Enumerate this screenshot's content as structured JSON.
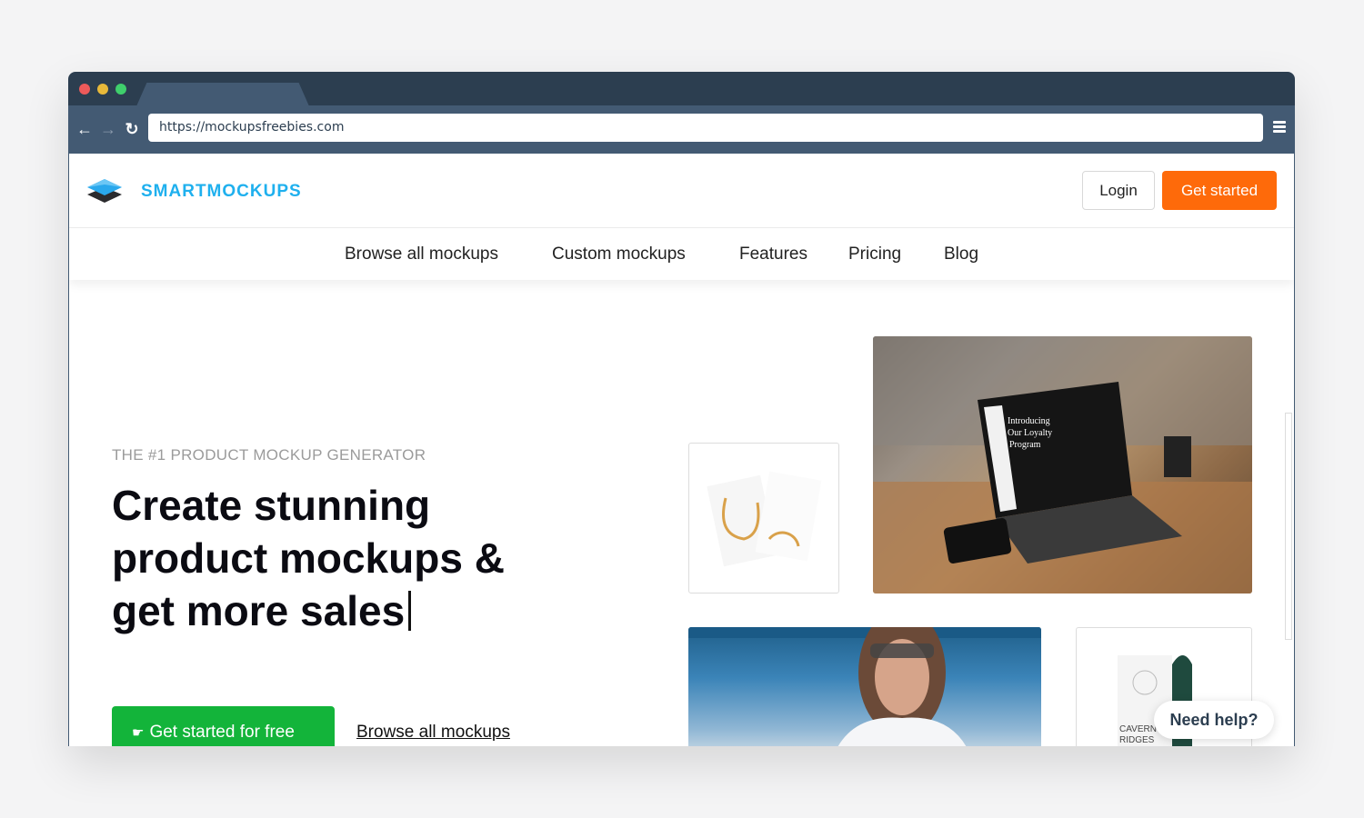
{
  "browser": {
    "url": "https://mockupsfreebies.com",
    "back_icon": "arrow-left-icon",
    "forward_icon": "arrow-right-icon",
    "reload_icon": "reload-icon",
    "menu_icon": "hamburger-menu-icon"
  },
  "header": {
    "brand": "SMARTMOCKUPS",
    "login_label": "Login",
    "get_started_label": "Get started",
    "colors": {
      "brand": "#1fb0ee",
      "cta": "#fe6a0a"
    }
  },
  "nav": {
    "items": [
      {
        "label": "Browse all mockups"
      },
      {
        "label": "Custom mockups"
      },
      {
        "label": "Features"
      },
      {
        "label": "Pricing"
      },
      {
        "label": "Blog"
      }
    ]
  },
  "hero": {
    "eyebrow": "THE #1 PRODUCT MOCKUP GENERATOR",
    "headline_lines": [
      "Create stunning",
      "product mockups &",
      "get more sales"
    ],
    "cta_label": "Get started for free",
    "cta_icon": "pointing-hand-icon",
    "secondary_link": "Browse all mockups",
    "colors": {
      "cta": "#13b43a"
    }
  },
  "gallery": {
    "laptop_screen_text": [
      "Introducing",
      "Our Loyalty",
      "Program"
    ],
    "coffee_bag_text": [
      "CAVERN",
      "RIDGES"
    ]
  },
  "help": {
    "label": "Need help?"
  }
}
